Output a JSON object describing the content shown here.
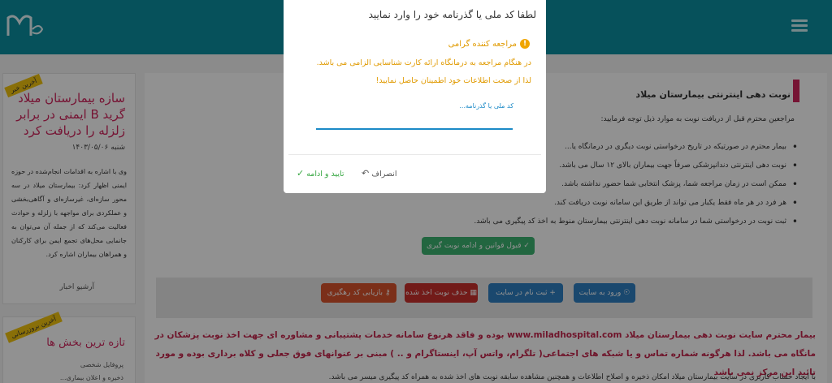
{
  "header": {
    "logo": "milad-logo"
  },
  "sidebar": {
    "news": {
      "ribbon": "آخرین خبر",
      "title": "سازه بیمارستان میلاد گرید B ایمنی در برابر زلزله را دریافت کرد",
      "date": "شنبه ۱۴۰۳/۰۵/۰۶",
      "body": "وی با اشاره به اقدامات انجام‌شده در حوزه ایمنی اظهار کرد: بیمارستان میلاد در سه محور سازه‌ای، غیرسازه‌ای و آگاهی‌بخشی و عملکردی برای مواجهه با زلزله و حوادث فعالیت می‌کند که از جمله آن می‌توان به جانمایی محل‌های تجمع ایمن برای کارکنان و همراهان بیماران اشاره کرد.",
      "archive_label": "آرشیو اخبار"
    },
    "latest": {
      "ribbon": "آخرین بروزرسانی",
      "title": "تازه ترین بخش ها",
      "items": [
        "پروفایل شخصی",
        "ذخیره و اعلان بیماری..."
      ]
    }
  },
  "main": {
    "title": "نوبت دهی اینترنتی بیمارستان میلاد",
    "intro": "مراجعین محترم قبل از دریافت نوبت به موارد ذیل توجه فرمایید:",
    "rules": [
      "بیمار محترم در صورتیکه در تاریخ درخواستی نوبت دیگری در درمانگاه یا...",
      "نوبت دهی اینترنتی دندانپزشکی صرفاً جهت بیماران بالای ۱۲ سال می باشد.",
      "ممکن است در زمان مراجعه شما، پزشک انتخابی شما حضور نداشته باشد.",
      "هر فرد در هر ماه فقط یکبار می تواند از طریق این سامانه نوبت دریافت کند.",
      "ثبت نوبت در درخواستی شما در سامانه نوبت دهی اینترنتی بیمارستان منوط به اخذ کد پیگیری می باشد."
    ],
    "accept_label": "قبول قوانین و ادامه نوبت گیری",
    "actions": {
      "login": "ورود به سایت",
      "register": "ثبت نام در سایت",
      "delete": "حذف نوبت اخذ شده",
      "retrieve": "بازیابی کد رهگیری"
    },
    "notice": "بیمار محترم سایت نوبت دهی بیمارستان میلاد www.miladhospital.com بوده و فاقد هرنوع سامانه خدمات پشتیبانی و مشاوره ای جهت اخذ نوبت پزشکان در مانگاه می باشد. لذا هرگونه شماره تماس و یا شبکه های اجتماعی( تلگرام، واتس آپ، اینستاگرام و .. ) مبنی بر عنوانهای فوق جعلی و کلاه برداری بوده و مورد تائید این مرکز نمی باشد",
    "notice_2": "با ایجاد حساب کاربری در سایت بیمارستان میلاد امکان ذخیره و اصلاح اطلاعات و همچنین مشاهده سابقه نوبت های اخذ شده به همراه کد پیگیری میسر می باشد."
  },
  "modal": {
    "title": "لطفا کد ملی یا گذرنامه خود را وارد نمایید",
    "warning_heading": "مراجعه کننده گرامی",
    "warning_line1": "در هنگام مراجعه به درمانگاه ارائه کارت شناسایی الزامی می باشد.",
    "warning_line2": "لذا از صحت اطلاعات خود اطمینان حاصل نمایید!",
    "field_placeholder": "کد ملی یا گذرنامه...",
    "confirm_label": "تایید و ادامه",
    "cancel_label": "انصراف",
    "colors": {
      "warning": "#e09a00",
      "field": "#1c8ac7",
      "confirm": "#3aa845"
    }
  },
  "colors": {
    "header": "#0c8fa0",
    "accent": "#d0245c",
    "overlay": "rgba(0,0,0,0.43)"
  },
  "icons": {
    "menu": "hamburger-icon",
    "warning": "exclamation-icon",
    "confirm": "check-icon",
    "cancel": "undo-arrow-icon"
  }
}
